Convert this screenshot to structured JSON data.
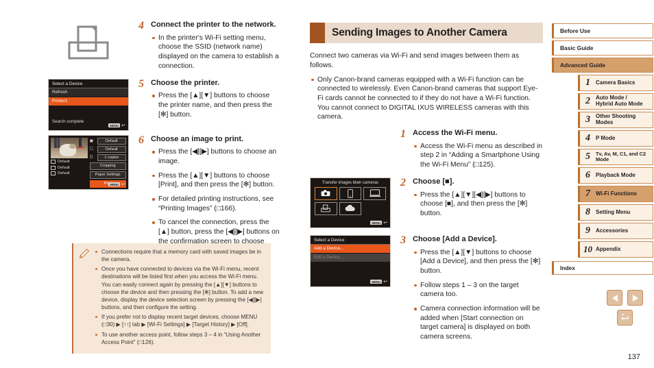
{
  "document": {
    "page_number": "137"
  },
  "left_column": {
    "printer_icon": "printer-outline-icon",
    "steps": [
      {
        "number": "4",
        "title": "Connect the printer to the network.",
        "bullets": [
          "In the printer's Wi-Fi setting menu, choose the SSID (network name) displayed on the camera to establish a connection."
        ]
      },
      {
        "number": "5",
        "title": "Choose the printer.",
        "bullets": [
          "Press the [▲][▼] buttons to choose the printer name, and then press the [✻] button."
        ]
      },
      {
        "number": "6",
        "title": "Choose an image to print.",
        "bullets": [
          "Press the [◀][▶] buttons to choose an image.",
          "Press the [▲][▼] buttons to choose [Print], and then press the [✻] button.",
          "For detailed printing instructions, see “Printing Images” (□166).",
          "To cancel the connection, press the [▲] button, press the [◀][▶] buttons on the confirmation screen to choose [OK], and then press the [✻] button."
        ]
      }
    ],
    "screen_select_device": {
      "title": "Select a Device",
      "items": [
        "Refresh",
        "Printer1"
      ],
      "selected_index": 1,
      "status": "Search complete",
      "footer_tag": "MENU",
      "footer_glyph": "↩"
    },
    "screen_print_settings": {
      "left_options": [
        "Default",
        "Default",
        "Default"
      ],
      "right_rows": [
        {
          "label": "Default"
        },
        {
          "label": "Default"
        },
        {
          "label": "1   copies"
        }
      ],
      "buttons": [
        "Cropping",
        "Paper Settings",
        "Print"
      ],
      "selected_button": "Print",
      "footer_tag": "MENU",
      "footer_glyph": "↩"
    }
  },
  "note_box": {
    "icon": "pencil-icon",
    "items": [
      "Connections require that a memory card with saved images be in the camera.",
      "Once you have connected to devices via the Wi-Fi menu, recent destinations will be listed first when you access the Wi-Fi menu. You can easily connect again by pressing the [▲][▼] buttons to choose the device and then pressing the [✻] button. To add a new device, display the device selection screen by pressing the [◀][▶] buttons, and then configure the setting.",
      "If you prefer not to display recent target devices, choose MENU (□30) ▶ [↑↑] tab ▶ [Wi-Fi Settings] ▶ [Target History] ▶ [Off].",
      "To use another access point, follow steps 3 – 4 in “Using Another Access Point” (□126)."
    ]
  },
  "right_column": {
    "section_title": "Sending Images to Another Camera",
    "intro": "Connect two cameras via Wi-Fi and send images between them as follows.",
    "intro_bullets": [
      "Only Canon-brand cameras equipped with a Wi-Fi function can be connected to wirelessly. Even Canon-brand cameras that support Eye-Fi cards cannot be connected to if they do not have a Wi-Fi function. You cannot connect to DIGITAL IXUS WIRELESS cameras with this camera."
    ],
    "steps": [
      {
        "number": "1",
        "title": "Access the Wi-Fi menu.",
        "bullets": [
          "Access the Wi-Fi menu as described in step 2 in “Adding a Smartphone Using the Wi-Fi Menu” (□125)."
        ]
      },
      {
        "number": "2",
        "title": "Choose [■].",
        "bullets": [
          "Press the [▲][▼][◀][▶] buttons to choose [■], and then press the [✻] button."
        ]
      },
      {
        "number": "3",
        "title": "Choose [Add a Device].",
        "bullets": [
          "Press the [▲][▼] buttons to choose [Add a Device], and then press the [✻] button.",
          "Follow steps 1 – 3 on the target camera too.",
          "Camera connection information will be added when [Start connection on target camera] is displayed on both camera screens."
        ]
      }
    ],
    "screen_wifi_menu": {
      "caption": "Transfer images btwn cameras",
      "cells": [
        "camera-icon",
        "smartphone-icon",
        "computer-icon",
        "printer-icon",
        "cloud-icon"
      ],
      "selected_cell": "camera-icon",
      "footer_tag": "MENU",
      "footer_glyph": "↩"
    },
    "screen_select_device": {
      "title": "Select a Device",
      "items": [
        "Add a Device...",
        "Edit a Device..."
      ],
      "selected_index": 0,
      "disabled_index": 1,
      "footer_tag": "MENU",
      "footer_glyph": "↩"
    }
  },
  "sidebar": {
    "top_items": [
      {
        "label": "Before Use",
        "active": false
      },
      {
        "label": "Basic Guide",
        "active": false
      },
      {
        "label": "Advanced Guide",
        "active": true
      }
    ],
    "chapters": [
      {
        "num": "1",
        "label": "Camera Basics",
        "active": false
      },
      {
        "num": "2",
        "label": "Auto Mode /\nHybrid Auto Mode",
        "active": false
      },
      {
        "num": "3",
        "label": "Other Shooting Modes",
        "active": false
      },
      {
        "num": "4",
        "label": "P Mode",
        "active": false
      },
      {
        "num": "5",
        "label": "Tv, Av, M, C1, and C2 Mode",
        "active": false
      },
      {
        "num": "6",
        "label": "Playback Mode",
        "active": false
      },
      {
        "num": "7",
        "label": "Wi-Fi Functions",
        "active": true
      },
      {
        "num": "8",
        "label": "Setting Menu",
        "active": false
      },
      {
        "num": "9",
        "label": "Accessories",
        "active": false
      },
      {
        "num": "10",
        "label": "Appendix",
        "active": false
      }
    ],
    "index_item": "Index"
  },
  "footer_nav": {
    "prev_icon": "triangle-left-icon",
    "next_icon": "triangle-right-icon",
    "home_icon": "return-home-icon"
  },
  "colors": {
    "accent_brown": "#a25420",
    "header_bg": "#e9dacb",
    "note_bg": "#f6e7d8",
    "nav_active": "#d6a06c",
    "lcd_selected": "#e8571b"
  }
}
